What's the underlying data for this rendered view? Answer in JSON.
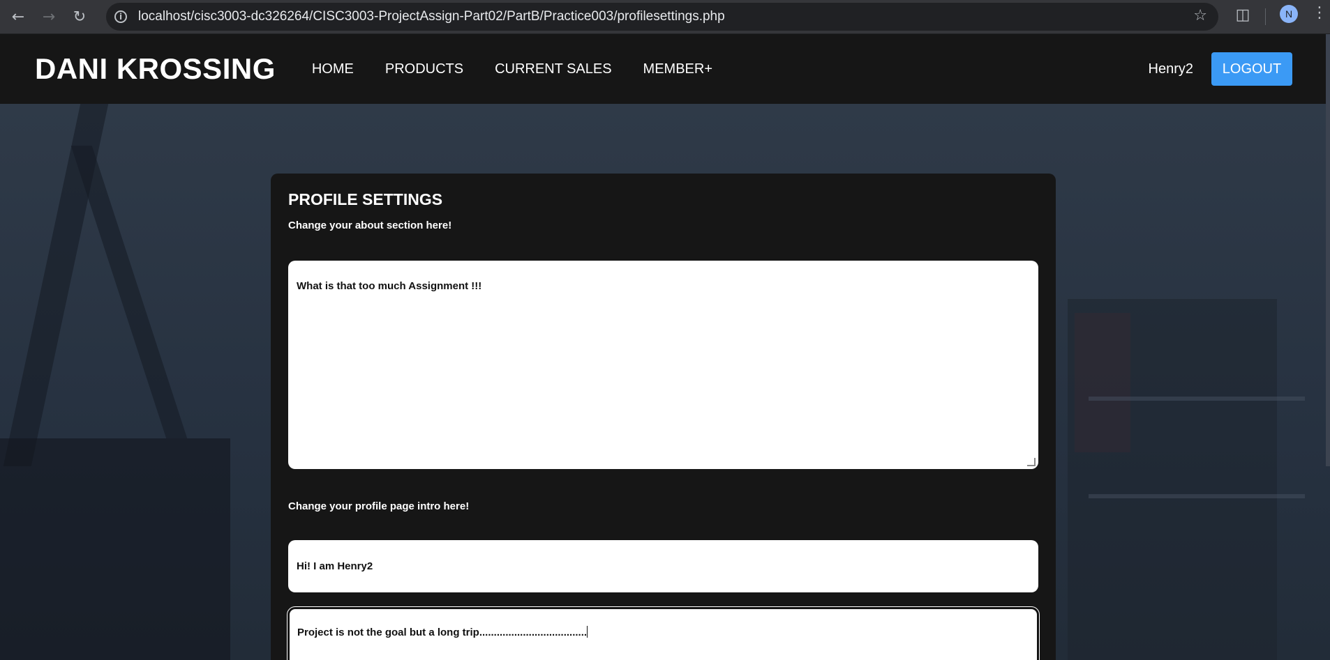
{
  "browser": {
    "url": "localhost/cisc3003-dc326264/CISC3003-ProjectAssign-Part02/PartB/Practice003/profilesettings.php",
    "profile_initial": "N"
  },
  "header": {
    "logo": "DANI KROSSING",
    "nav": [
      "HOME",
      "PRODUCTS",
      "CURRENT SALES",
      "MEMBER+"
    ],
    "username": "Henry2",
    "logout_label": "LOGOUT"
  },
  "profile_settings": {
    "title": "PROFILE SETTINGS",
    "about_label": "Change your about section here!",
    "about_value": "What is that too much Assignment !!!",
    "intro_label": "Change your profile page intro here!",
    "intro_title_value": "Hi! I am Henry2",
    "intro_text_value": "Project is not the goal but a long trip....................................."
  },
  "colors": {
    "header_bg": "#161616",
    "panel_bg": "#161616",
    "logout_button": "#3b9af5"
  },
  "icons": [
    "back-icon",
    "forward-icon",
    "reload-icon",
    "info-icon",
    "star-icon",
    "extensions-icon",
    "kebab-menu-icon",
    "resize-grip-icon"
  ]
}
